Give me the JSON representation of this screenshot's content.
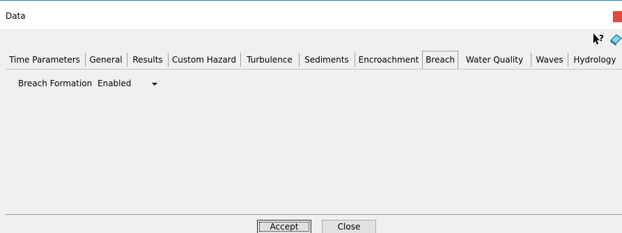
{
  "window": {
    "title": "Data",
    "close_label": "×"
  },
  "toolbar": {
    "help_icon": "whats-this-help-icon",
    "eraser_icon": "eraser-icon"
  },
  "tabs": [
    {
      "label": "Time Parameters"
    },
    {
      "label": "General"
    },
    {
      "label": "Results"
    },
    {
      "label": "Custom Hazard"
    },
    {
      "label": "Turbulence"
    },
    {
      "label": "Sediments"
    },
    {
      "label": "Encroachment"
    },
    {
      "label": "Breach",
      "active": true
    },
    {
      "label": "Water Quality"
    },
    {
      "label": "Waves"
    },
    {
      "label": "Hydrology"
    }
  ],
  "breach": {
    "formation_label": "Breach Formation",
    "formation_value": "Enabled"
  },
  "buttons": {
    "accept": "Accept",
    "close": "Close"
  },
  "colors": {
    "title_accent": "#1a80d6",
    "close_button": "#e04a3a",
    "background": "#f0f0f0"
  }
}
